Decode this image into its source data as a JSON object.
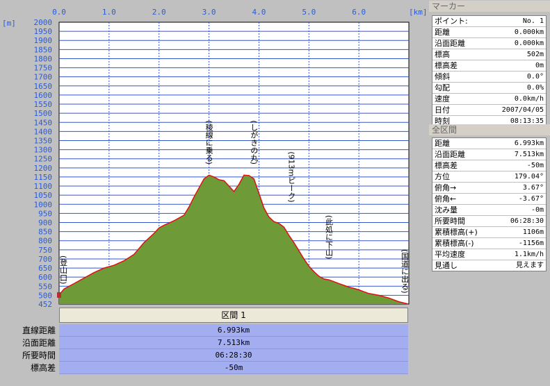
{
  "chart_data": {
    "type": "area",
    "xlabel": "",
    "ylabel": "",
    "x_unit": "[km]",
    "y_unit": "[m]",
    "xlim": [
      0,
      7.0
    ],
    "ylim": [
      452,
      2000
    ],
    "x_ticks": [
      "0.0",
      "1.0",
      "2.0",
      "3.0",
      "4.0",
      "5.0",
      "6.0"
    ],
    "y_ticks": [
      "2000",
      "1950",
      "1900",
      "1850",
      "1800",
      "1750",
      "1700",
      "1650",
      "1600",
      "1550",
      "1500",
      "1450",
      "1400",
      "1350",
      "1300",
      "1250",
      "1200",
      "1150",
      "1100",
      "1050",
      "1000",
      "950",
      "900",
      "850",
      "800",
      "750",
      "700",
      "650",
      "600",
      "550",
      "500",
      "452"
    ],
    "grid": true,
    "fill_color": "#6e9a37",
    "line_color": "#e01010",
    "plot_bg": "#ffffff",
    "series": [
      {
        "x": [
          0.0,
          0.1,
          0.3,
          0.5,
          0.7,
          0.9,
          1.1,
          1.3,
          1.5,
          1.7,
          1.9,
          2.0,
          2.1,
          2.3,
          2.5,
          2.6,
          2.7,
          2.8,
          2.9,
          3.0,
          3.1,
          3.2,
          3.3,
          3.4,
          3.5,
          3.6,
          3.7,
          3.8,
          3.9,
          4.0,
          4.1,
          4.2,
          4.3,
          4.4,
          4.5,
          4.6,
          4.7,
          4.8,
          4.9,
          5.0,
          5.1,
          5.2,
          5.3,
          5.4,
          5.5,
          5.6,
          5.7,
          5.8,
          5.9,
          6.0,
          6.1,
          6.2,
          6.4,
          6.6,
          6.8,
          6.993
        ],
        "y": [
          502,
          535,
          565,
          595,
          625,
          650,
          665,
          690,
          725,
          790,
          840,
          870,
          885,
          910,
          940,
          985,
          1040,
          1090,
          1140,
          1160,
          1150,
          1135,
          1130,
          1100,
          1070,
          1110,
          1160,
          1158,
          1140,
          1060,
          980,
          930,
          905,
          895,
          875,
          830,
          790,
          745,
          700,
          660,
          630,
          605,
          590,
          585,
          575,
          565,
          555,
          545,
          538,
          530,
          520,
          510,
          500,
          485,
          465,
          452
        ]
      }
    ],
    "annotations": [
      {
        "x": 0.0,
        "y": 502,
        "text": "(登山口)"
      },
      {
        "x": 3.0,
        "y": 1160,
        "text": "(稜線に乗る)"
      },
      {
        "x": 3.9,
        "y": 1160,
        "text": "(しがきの丸)"
      },
      {
        "x": 4.65,
        "y": 905,
        "text": "(913mピーク)"
      },
      {
        "x": 5.4,
        "y": 640,
        "text": "(此処に下山)"
      },
      {
        "x": 6.993,
        "y": 452,
        "text": "(国道に出る)"
      }
    ]
  },
  "section": {
    "header": "区間 1",
    "rows": [
      {
        "label": "直線距離",
        "value": "6.993km"
      },
      {
        "label": "沿面距離",
        "value": "7.513km"
      },
      {
        "label": "所要時間",
        "value": "06:28:30"
      },
      {
        "label": "標高差",
        "value": "-50m"
      }
    ]
  },
  "marker_panel": {
    "title": "マーカー",
    "rows": [
      {
        "k": "ポイント:",
        "v": "No. 1"
      },
      {
        "k": "距離",
        "v": "0.000km"
      },
      {
        "k": "沿面距離",
        "v": "0.000km"
      },
      {
        "k": "標高",
        "v": "502m"
      },
      {
        "k": "標高差",
        "v": "0m"
      },
      {
        "k": "傾斜",
        "v": "0.0°"
      },
      {
        "k": "勾配",
        "v": "0.0%"
      },
      {
        "k": "速度",
        "v": "0.0km/h"
      },
      {
        "k": "日付",
        "v": "2007/04/05"
      },
      {
        "k": "時刻",
        "v": "08:13:35"
      }
    ]
  },
  "total_panel": {
    "title": "全区間",
    "rows": [
      {
        "k": "距離",
        "v": "6.993km"
      },
      {
        "k": "沿面距離",
        "v": "7.513km"
      },
      {
        "k": "標高差",
        "v": "-50m"
      },
      {
        "k": "方位",
        "v": "179.04°"
      },
      {
        "k": "俯角→",
        "v": "3.67°"
      },
      {
        "k": "俯角←",
        "v": "-3.67°"
      },
      {
        "k": "沈み量",
        "v": "-0m"
      },
      {
        "k": "所要時間",
        "v": "06:28:30"
      },
      {
        "k": "累積標高(+)",
        "v": "1106m"
      },
      {
        "k": "累積標高(-)",
        "v": "-1156m"
      },
      {
        "k": "平均速度",
        "v": "1.1km/h"
      },
      {
        "k": "見通し",
        "v": "見えます"
      }
    ]
  }
}
